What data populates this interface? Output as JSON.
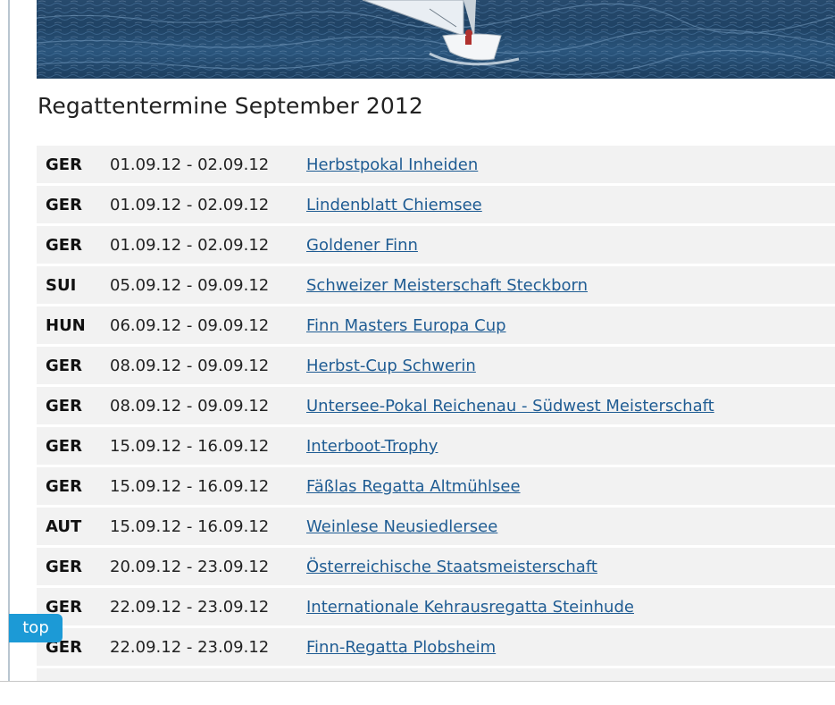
{
  "page": {
    "title": "Regattentermine September 2012"
  },
  "hero": {
    "image_name": "sailboat-on-water-banner"
  },
  "regattas": [
    {
      "country": "GER",
      "dates": "01.09.12 - 02.09.12",
      "event": "Herbstpokal Inheiden"
    },
    {
      "country": "GER",
      "dates": "01.09.12 - 02.09.12",
      "event": "Lindenblatt Chiemsee"
    },
    {
      "country": "GER",
      "dates": "01.09.12 - 02.09.12",
      "event": "Goldener Finn"
    },
    {
      "country": "SUI",
      "dates": "05.09.12 - 09.09.12",
      "event": "Schweizer Meisterschaft Steckborn"
    },
    {
      "country": "HUN",
      "dates": "06.09.12 - 09.09.12",
      "event": "Finn Masters Europa Cup"
    },
    {
      "country": "GER",
      "dates": "08.09.12 - 09.09.12",
      "event": "Herbst-Cup Schwerin"
    },
    {
      "country": "GER",
      "dates": "08.09.12 - 09.09.12",
      "event": "Untersee-Pokal Reichenau - Südwest Meisterschaft"
    },
    {
      "country": "GER",
      "dates": "15.09.12 - 16.09.12",
      "event": "Interboot-Trophy"
    },
    {
      "country": "GER",
      "dates": "15.09.12 - 16.09.12",
      "event": "Fäßlas Regatta Altmühlsee"
    },
    {
      "country": "AUT",
      "dates": "15.09.12 - 16.09.12",
      "event": "Weinlese Neusiedlersee"
    },
    {
      "country": "GER",
      "dates": "20.09.12 - 23.09.12",
      "event": "Österreichische Staatsmeisterschaft"
    },
    {
      "country": "GER",
      "dates": "22.09.12 - 23.09.12",
      "event": "Internationale Kehrausregatta Steinhude"
    },
    {
      "country": "GER",
      "dates": "22.09.12 - 23.09.12",
      "event": "Finn-Regatta Plobsheim"
    }
  ],
  "top_button": {
    "label": "top"
  },
  "colors": {
    "link": "#1f5c93",
    "row_background": "#f2f2f2",
    "top_button": "#1c9ad6"
  }
}
